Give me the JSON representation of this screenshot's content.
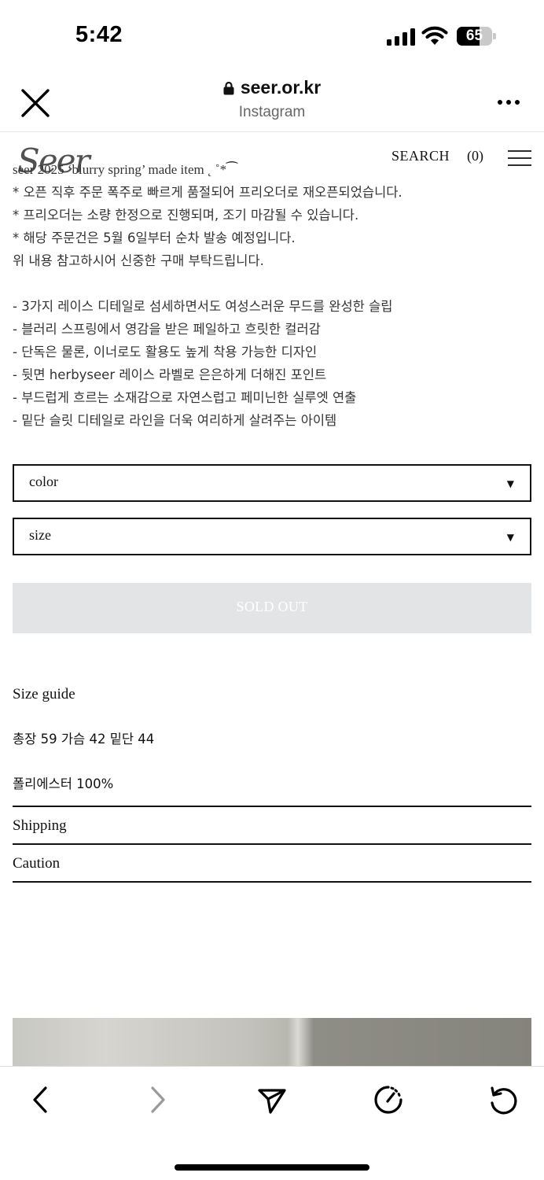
{
  "status_bar": {
    "time": "5:42",
    "battery_percent": "65",
    "battery_level": 0.65
  },
  "browser": {
    "url": "seer.or.kr",
    "source": "Instagram"
  },
  "site_header": {
    "logo": "Seer",
    "search": "SEARCH",
    "cart": "(0)"
  },
  "description": {
    "title": "seer 2025 ‘blurry spring’ made item ˛ ˚*⁀",
    "notices": [
      "* 오픈 직후 주문 폭주로 빠르게 품절되어 프리오더로 재오픈되었습니다.",
      "* 프리오더는 소량 한정으로 진행되며, 조기 마감될 수 있습니다.",
      "* 해당 주문건은 5월 6일부터 순차 발송 예정입니다.",
      "위 내용 참고하시어 신중한 구매 부탁드립니다."
    ],
    "features": [
      "- 3가지 레이스 디테일로 섬세하면서도 여성스러운 무드를 완성한 슬립",
      "- 블러리 스프링에서 영감을 받은 페일하고 흐릿한 컬러감",
      "- 단독은 물론, 이너로도 활용도 높게 착용 가능한 디자인",
      "- 뒷면 herbyseer 레이스 라벨로 은은하게 더해진 포인트",
      "- 부드럽게 흐르는 소재감으로 자연스럽고 페미닌한 실루엣 연출",
      "- 밑단 슬릿 디테일로 라인을 더욱 여리하게 살려주는 아이템"
    ]
  },
  "options": {
    "color_label": "color",
    "size_label": "size",
    "arrow": "▼"
  },
  "buy": {
    "soldout_label": "SOLD OUT"
  },
  "info": {
    "size_guide_title": "Size guide",
    "size_guide_value": "총장 59 가슴 42 밑단 44",
    "material": "폴리에스터 100%",
    "shipping": "Shipping",
    "caution": "Caution"
  },
  "icons": [
    "signal-icon",
    "wifi-icon",
    "close-icon",
    "lock-icon",
    "more-icon",
    "hamburger-icon",
    "back-icon",
    "forward-icon",
    "share-icon",
    "speed-icon",
    "reload-icon"
  ]
}
